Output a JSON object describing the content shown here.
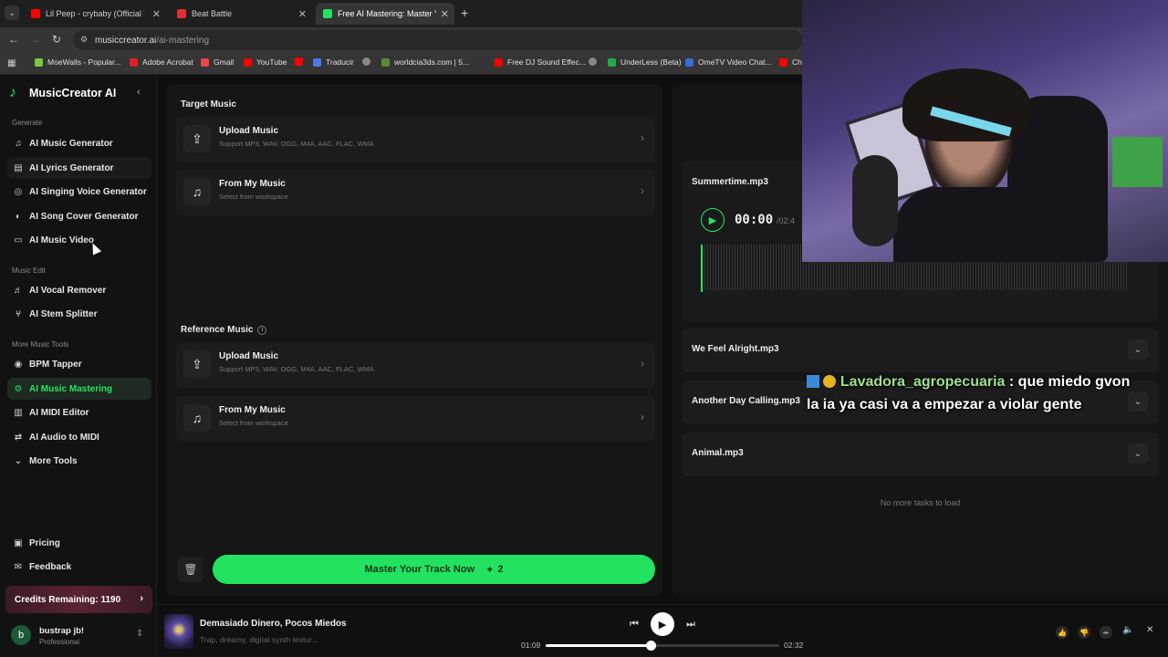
{
  "browser": {
    "tabs": [
      {
        "title": "Lil Peep - crybaby (Official Vide",
        "color": "#ff0000"
      },
      {
        "title": "Beat Battle",
        "color": "#e03030"
      },
      {
        "title": "Free AI Mastering: Master Your",
        "color": "#22e25f"
      }
    ],
    "url_host": "musiccreator.ai",
    "url_path": "/ai-mastering",
    "bookmarks": [
      {
        "label": "MoeWalls - Popular...",
        "color": "#7ac943"
      },
      {
        "label": "Adobe Acrobat",
        "color": "#e02020"
      },
      {
        "label": "Gmail",
        "color": "#e44"
      },
      {
        "label": "YouTube",
        "color": "#f00"
      },
      {
        "label": "",
        "color": "#f00"
      },
      {
        "label": "Traducir",
        "color": "#4a7ae8"
      },
      {
        "label": "",
        "color": "#888"
      },
      {
        "label": "worldcia3ds.com | 5...",
        "color": "#5a8a3a"
      },
      {
        "label": "Free DJ Sound Effec...",
        "color": "#f00"
      },
      {
        "label": "",
        "color": "#888"
      },
      {
        "label": "UnderLess (Beta)",
        "color": "#22aa44"
      },
      {
        "label": "OmeTV Video Chat...",
        "color": "#3a6ad8"
      },
      {
        "label": "Ch",
        "color": "#f00"
      }
    ]
  },
  "sidebar": {
    "brand": "MusicCreator AI",
    "sections": [
      {
        "heading": "Generate",
        "items": [
          {
            "label": "AI Music Generator",
            "icon": "music-icon"
          },
          {
            "label": "AI Lyrics Generator",
            "icon": "lyrics-icon"
          },
          {
            "label": "AI Singing Voice Generator",
            "icon": "mic-icon"
          },
          {
            "label": "AI Song Cover Generator",
            "icon": "cover-icon"
          },
          {
            "label": "AI Music Video",
            "icon": "video-icon"
          }
        ]
      },
      {
        "heading": "Music Edit",
        "items": [
          {
            "label": "AI Vocal Remover",
            "icon": "vocal-icon"
          },
          {
            "label": "AI Stem Splitter",
            "icon": "split-icon"
          }
        ]
      },
      {
        "heading": "More Music Tools",
        "items": [
          {
            "label": "BPM Tapper",
            "icon": "tap-icon"
          },
          {
            "label": "AI Music Mastering",
            "icon": "mastering-icon"
          },
          {
            "label": "AI MIDI Editor",
            "icon": "midi-icon"
          },
          {
            "label": "AI Audio to MIDI",
            "icon": "audio-midi-icon"
          },
          {
            "label": "More Tools",
            "icon": "chevron-down-icon"
          }
        ]
      }
    ],
    "pricing": "Pricing",
    "feedback": "Feedback",
    "credits": "Credits Remaining: 1190",
    "user_initial": "b",
    "user_name": "bustrap jb!",
    "user_plan": "Professional"
  },
  "main": {
    "target_title": "Target Music",
    "reference_title": "Reference Music",
    "upload_title": "Upload Music",
    "upload_sub": "Support MP3, WAV, OGG, M4A, AAC, FLAC, WMA",
    "from_title": "From My Music",
    "from_sub": "Select from workspace",
    "master_label": "Master Your Track Now",
    "master_cost": "2"
  },
  "tasks": {
    "current": {
      "name": "Summertime.mp3",
      "time": "00:00",
      "duration": "/02:4"
    },
    "items": [
      "We Feel Alright.mp3",
      "Another Day Calling.mp3",
      "Animal.mp3"
    ],
    "empty": "No more tasks to load"
  },
  "player": {
    "title": "Demasiado Dinero, Pocos Miedos",
    "subtitle": "Trap, dreamy, digital synth textur...",
    "elapsed": "01:09",
    "total": "02:32",
    "progress": 0.45
  },
  "chat": {
    "user": "Lavadora_agropecuaria",
    "line1": ": que miedo gvon",
    "line2": "la ia ya casi va a empezar a violar gente"
  }
}
